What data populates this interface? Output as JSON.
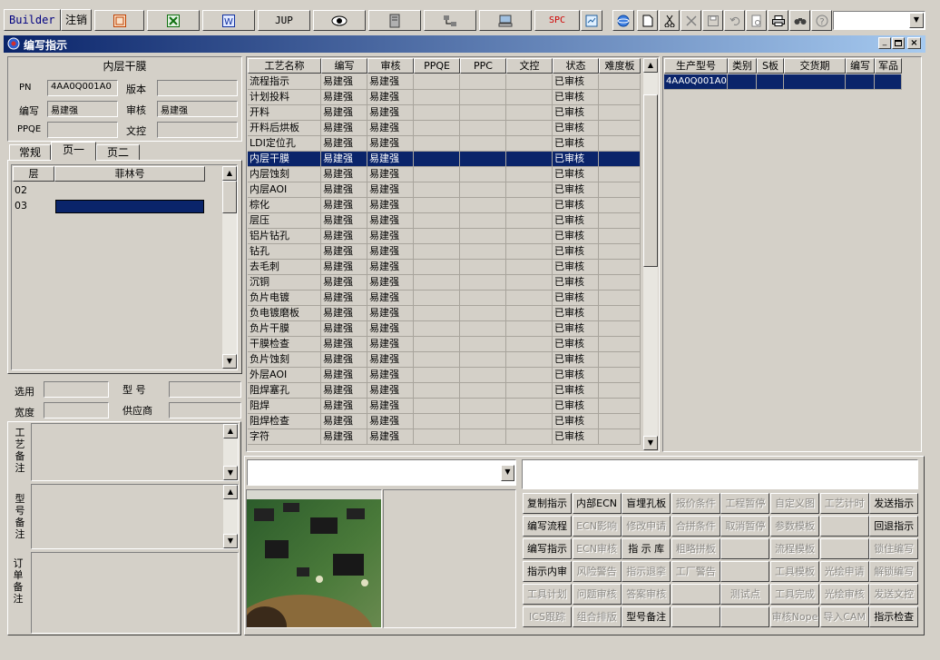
{
  "toolbar": {
    "builder": "Builder",
    "logout": "注销",
    "jup": "JUP",
    "spc": "SPC"
  },
  "window": {
    "title": "编写指示"
  },
  "left": {
    "header": "内层干膜",
    "pn_label": "PN",
    "pn_value": "4AA0Q001A0",
    "version_label": "版本",
    "version_value": "",
    "writer_label": "编写",
    "writer_value": "易建强",
    "reviewer_label": "审核",
    "reviewer_value": "易建强",
    "ppqe_label": "PPQE",
    "ppqe_value": "",
    "doc_label": "文控",
    "doc_value": "",
    "tabs": [
      "常规",
      "页一",
      "页二"
    ],
    "layer_headers": [
      "层",
      "菲林号"
    ],
    "layer_rows": [
      [
        "02",
        ""
      ],
      [
        "03",
        ""
      ]
    ],
    "select_label": "选用",
    "model_label": "型 号",
    "width_label": "宽度",
    "supplier_label": "供应商",
    "process_note": "工艺备注",
    "model_note": "型号备注",
    "order_note": "订单备注"
  },
  "process_table": {
    "headers": [
      "工艺名称",
      "编写",
      "审核",
      "PPQE",
      "PPC",
      "文控",
      "状态",
      "难度板"
    ],
    "rows": [
      [
        "流程指示",
        "易建强",
        "易建强",
        "",
        "",
        "",
        "已审核",
        ""
      ],
      [
        "计划投料",
        "易建强",
        "易建强",
        "",
        "",
        "",
        "已审核",
        ""
      ],
      [
        "开料",
        "易建强",
        "易建强",
        "",
        "",
        "",
        "已审核",
        ""
      ],
      [
        "开料后烘板",
        "易建强",
        "易建强",
        "",
        "",
        "",
        "已审核",
        ""
      ],
      [
        "LDI定位孔",
        "易建强",
        "易建强",
        "",
        "",
        "",
        "已审核",
        ""
      ],
      [
        "内层干膜",
        "易建强",
        "易建强",
        "",
        "",
        "",
        "已审核",
        ""
      ],
      [
        "内层蚀刻",
        "易建强",
        "易建强",
        "",
        "",
        "",
        "已审核",
        ""
      ],
      [
        "内层AOI",
        "易建强",
        "易建强",
        "",
        "",
        "",
        "已审核",
        ""
      ],
      [
        "棕化",
        "易建强",
        "易建强",
        "",
        "",
        "",
        "已审核",
        ""
      ],
      [
        "层压",
        "易建强",
        "易建强",
        "",
        "",
        "",
        "已审核",
        ""
      ],
      [
        "铝片钻孔",
        "易建强",
        "易建强",
        "",
        "",
        "",
        "已审核",
        ""
      ],
      [
        "钻孔",
        "易建强",
        "易建强",
        "",
        "",
        "",
        "已审核",
        ""
      ],
      [
        "去毛刺",
        "易建强",
        "易建强",
        "",
        "",
        "",
        "已审核",
        ""
      ],
      [
        "沉铜",
        "易建强",
        "易建强",
        "",
        "",
        "",
        "已审核",
        ""
      ],
      [
        "负片电镀",
        "易建强",
        "易建强",
        "",
        "",
        "",
        "已审核",
        ""
      ],
      [
        "负电镀磨板",
        "易建强",
        "易建强",
        "",
        "",
        "",
        "已审核",
        ""
      ],
      [
        "负片干膜",
        "易建强",
        "易建强",
        "",
        "",
        "",
        "已审核",
        ""
      ],
      [
        "干膜检查",
        "易建强",
        "易建强",
        "",
        "",
        "",
        "已审核",
        ""
      ],
      [
        "负片蚀刻",
        "易建强",
        "易建强",
        "",
        "",
        "",
        "已审核",
        ""
      ],
      [
        "外层AOI",
        "易建强",
        "易建强",
        "",
        "",
        "",
        "已审核",
        ""
      ],
      [
        "阻焊塞孔",
        "易建强",
        "易建强",
        "",
        "",
        "",
        "已审核",
        ""
      ],
      [
        "阻焊",
        "易建强",
        "易建强",
        "",
        "",
        "",
        "已审核",
        ""
      ],
      [
        "阻焊检查",
        "易建强",
        "易建强",
        "",
        "",
        "",
        "已审核",
        ""
      ],
      [
        "字符",
        "易建强",
        "易建强",
        "",
        "",
        "",
        "已审核",
        ""
      ]
    ]
  },
  "product_table": {
    "headers": [
      "生产型号",
      "类别",
      "S板",
      "交货期",
      "编写",
      "军品"
    ],
    "rows": [
      [
        "4AA0Q001A0",
        "",
        "",
        "",
        "",
        ""
      ]
    ]
  },
  "buttons": [
    [
      "复制指示",
      "内部ECN",
      "盲埋孔板",
      "报价条件",
      "工程暂停",
      "自定义图",
      "工艺计时",
      "发送指示"
    ],
    [
      "编写流程",
      "ECN影响",
      "修改申请",
      "合拼条件",
      "取消暂停",
      "参数模板",
      "",
      "回退指示"
    ],
    [
      "编写指示",
      "ECN审核",
      "指 示 库",
      "粗略拼板",
      "",
      "流程模板",
      "",
      "锁住编写"
    ],
    [
      "指示内审",
      "风险警告",
      "指示退挛",
      "工厂警告",
      "",
      "工具模板",
      "光绘申请",
      "解锁编写"
    ],
    [
      "工具计划",
      "问题审核",
      "答案审核",
      "",
      "测试点",
      "工具完成",
      "光绘审核",
      "发送文控"
    ],
    [
      "ICS跟踪",
      "组合排版",
      "型号备注",
      "",
      "",
      "审核Nope",
      "导入CAM",
      "指示检查"
    ]
  ],
  "buttons_enabled": [
    [
      true,
      true,
      true,
      false,
      false,
      false,
      false,
      true
    ],
    [
      true,
      false,
      false,
      false,
      false,
      false,
      false,
      true
    ],
    [
      true,
      false,
      true,
      false,
      false,
      false,
      false,
      false
    ],
    [
      true,
      false,
      false,
      false,
      false,
      false,
      false,
      false
    ],
    [
      false,
      false,
      false,
      false,
      false,
      false,
      false,
      false
    ],
    [
      false,
      false,
      true,
      false,
      false,
      false,
      false,
      true
    ]
  ]
}
